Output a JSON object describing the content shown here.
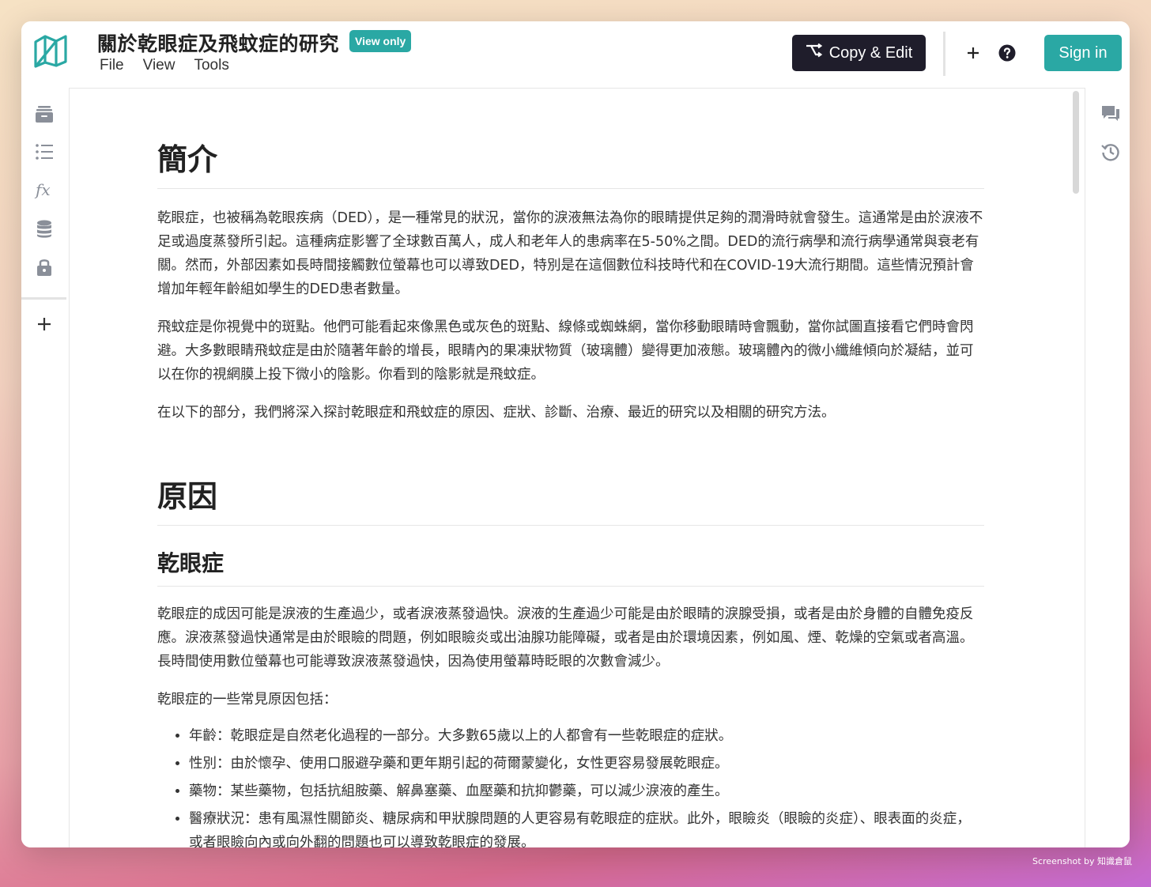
{
  "header": {
    "title": "關於乾眼症及飛蚊症的研究",
    "badge": "View only",
    "menu": [
      "File",
      "View",
      "Tools"
    ],
    "copy_edit_label": "Copy & Edit",
    "sign_in_label": "Sign in"
  },
  "icons": {
    "logo": "notebook-logo-icon",
    "copy_edit": "fork-icon",
    "add": "plus-icon",
    "help": "help-circle-icon",
    "left_sidebar": [
      "archive-icon",
      "list-icon",
      "function-icon",
      "database-icon",
      "lock-icon",
      "plus-icon"
    ],
    "right_sidebar": [
      "comments-icon",
      "history-icon"
    ]
  },
  "colors": {
    "accent": "#2aa8a4",
    "dark_button": "#1f1d2b"
  },
  "content": {
    "section1": {
      "heading": "簡介",
      "paragraphs": [
        "乾眼症，也被稱為乾眼疾病（DED），是一種常見的狀況，當你的淚液無法為你的眼睛提供足夠的潤滑時就會發生。這通常是由於淚液不足或過度蒸發所引起。這種病症影響了全球數百萬人，成人和老年人的患病率在5-50%之間。DED的流行病學和流行病學通常與衰老有關。然而，外部因素如長時間接觸數位螢幕也可以導致DED，特別是在這個數位科技時代和在COVID-19大流行期間。這些情況預計會增加年輕年齡組如學生的DED患者數量。",
        "飛蚊症是你視覺中的斑點。他們可能看起來像黑色或灰色的斑點、線條或蜘蛛網，當你移動眼睛時會飄動，當你試圖直接看它們時會閃避。大多數眼睛飛蚊症是由於隨著年齡的增長，眼睛內的果凍狀物質（玻璃體）變得更加液態。玻璃體內的微小纖維傾向於凝結，並可以在你的視網膜上投下微小的陰影。你看到的陰影就是飛蚊症。",
        "在以下的部分，我們將深入探討乾眼症和飛蚊症的原因、症狀、診斷、治療、最近的研究以及相關的研究方法。"
      ]
    },
    "section2": {
      "heading": "原因",
      "subheading": "乾眼症",
      "paragraphs": [
        "乾眼症的成因可能是淚液的生產過少，或者淚液蒸發過快。淚液的生產過少可能是由於眼睛的淚腺受損，或者是由於身體的自體免疫反應。淚液蒸發過快通常是由於眼瞼的問題，例如眼瞼炎或出油腺功能障礙，或者是由於環境因素，例如風、煙、乾燥的空氣或者高溫。長時間使用數位螢幕也可能導致淚液蒸發過快，因為使用螢幕時眨眼的次數會減少。",
        "乾眼症的一些常見原因包括："
      ],
      "bullets": [
        "年齡：乾眼症是自然老化過程的一部分。大多數65歲以上的人都會有一些乾眼症的症狀。",
        "性別：由於懷孕、使用口服避孕藥和更年期引起的荷爾蒙變化，女性更容易發展乾眼症。",
        "藥物：某些藥物，包括抗組胺藥、解鼻塞藥、血壓藥和抗抑鬱藥，可以減少淚液的產生。",
        "醫療狀況：患有風濕性關節炎、糖尿病和甲狀腺問題的人更容易有乾眼症的症狀。此外，眼瞼炎（眼瞼的炎症）、眼表面的炎症，或者眼瞼向內或向外翻的問題也可以導致乾眼症的發展。"
      ]
    }
  },
  "footer": {
    "watermark": "Screenshot by 知識倉鼠"
  }
}
